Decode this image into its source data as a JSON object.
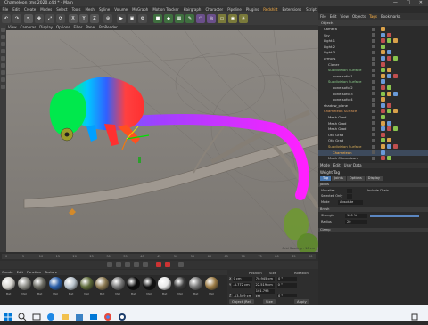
{
  "window": {
    "title": "Chameleon tms 2020.c4d * - Main",
    "controls": "— □ ✕"
  },
  "menubar": [
    "File",
    "Edit",
    "Create",
    "Modes",
    "Select",
    "Tools",
    "Mesh",
    "Spline",
    "Volume",
    "MoGraph",
    "Motion Tracker",
    "Hairgraph",
    "Character",
    "Pipeline",
    "Plugins",
    "Redshift",
    "Extensions",
    "Script",
    "Window",
    "Help"
  ],
  "menubar_highlight": "Redshift",
  "viewport": {
    "menu": [
      "View",
      "Cameras",
      "Display",
      "Options",
      "Filter",
      "Panel",
      "ProRender"
    ],
    "grid_spacing": "Grid Spacing : 10 cm"
  },
  "timeline": {
    "ticks": [
      "0",
      "5",
      "10",
      "15",
      "20",
      "25",
      "30",
      "35",
      "40",
      "45",
      "50",
      "55",
      "60",
      "65",
      "70",
      "75",
      "80",
      "85",
      "90"
    ]
  },
  "materials": {
    "menu": [
      "Create",
      "Edit",
      "Function",
      "Texture"
    ],
    "swatches": [
      {
        "label": "Mat",
        "color": "#d8d6d0"
      },
      {
        "label": "Mat",
        "color": "#8a8a84"
      },
      {
        "label": "Mat",
        "color": "#6a6a62"
      },
      {
        "label": "Mat",
        "color": "#2c5fa8"
      },
      {
        "label": "Mat",
        "color": "#b9c3cc"
      },
      {
        "label": "Mat",
        "color": "#5e6b3a"
      },
      {
        "label": "Mat",
        "color": "#8c7a52"
      },
      {
        "label": "Mat",
        "color": "#777"
      },
      {
        "label": "Mat",
        "color": "#0b0b0b"
      },
      {
        "label": "Mat",
        "color": "#111"
      },
      {
        "label": "Mat",
        "color": "#e8e8e8"
      },
      {
        "label": "Mat",
        "color": "#3c3c3c"
      },
      {
        "label": "Mat",
        "color": "#777"
      },
      {
        "label": "Mat",
        "color": "#9b7b45"
      }
    ]
  },
  "coordinates": {
    "headers": [
      "Position",
      "Size",
      "Rotation"
    ],
    "rows": [
      {
        "axis": "X",
        "pos": "0 cm",
        "size": "70.945 cm",
        "rot": "0 °"
      },
      {
        "axis": "Y",
        "pos": "-4.772 cm",
        "size": "22.519 cm",
        "rot": "0 °"
      },
      {
        "axis": "Z",
        "pos": "-13.549 cm",
        "size": "101.795 cm",
        "rot": "0 °"
      }
    ],
    "mode": "Object (Rel)",
    "size_mode": "Size",
    "apply": "Apply"
  },
  "objects_panel": {
    "menu": [
      "File",
      "Edit",
      "View",
      "Objects",
      "Tags",
      "Bookmarks"
    ],
    "menu_highlight": "Tags",
    "header": "Objects",
    "items": [
      {
        "name": "Camera",
        "indent": 0,
        "color": "#cfcfcf"
      },
      {
        "name": "Sky",
        "indent": 0,
        "color": "#cfcfcf"
      },
      {
        "name": "Light.1",
        "indent": 0,
        "color": "#cfcfcf"
      },
      {
        "name": "Light.2",
        "indent": 0,
        "color": "#cfcfcf"
      },
      {
        "name": "Light.3",
        "indent": 0,
        "color": "#cfcfcf"
      },
      {
        "name": "armors",
        "indent": 0,
        "color": "#cfcfcf"
      },
      {
        "name": "Cloner",
        "indent": 1,
        "color": "#cfcfcf"
      },
      {
        "name": "Subdivision Surface",
        "indent": 1,
        "color": "#8fd18f"
      },
      {
        "name": "bone.sofor1",
        "indent": 2,
        "color": "#cfcfcf"
      },
      {
        "name": "Subdivision Surface",
        "indent": 1,
        "color": "#8fd18f"
      },
      {
        "name": "bone.sofor2",
        "indent": 2,
        "color": "#cfcfcf"
      },
      {
        "name": "bone.sofor3",
        "indent": 2,
        "color": "#cfcfcf"
      },
      {
        "name": "bone.sofor4",
        "indent": 2,
        "color": "#cfcfcf"
      },
      {
        "name": "shadow_plane",
        "indent": 0,
        "color": "#cfcfcf"
      },
      {
        "name": "Chameleon Surface",
        "indent": 0,
        "color": "#e09a5a"
      },
      {
        "name": "Mesh Grad",
        "indent": 1,
        "color": "#cfcfcf"
      },
      {
        "name": "Mesh Grad",
        "indent": 1,
        "color": "#cfcfcf"
      },
      {
        "name": "Mesh Grad",
        "indent": 1,
        "color": "#cfcfcf"
      },
      {
        "name": "Oth Grad",
        "indent": 1,
        "color": "#cfcfcf"
      },
      {
        "name": "Oth Grad",
        "indent": 1,
        "color": "#cfcfcf"
      },
      {
        "name": "Subdivision Surface",
        "indent": 1,
        "color": "#e0b35a"
      },
      {
        "name": "Chameleon",
        "indent": 2,
        "color": "#ffb347"
      },
      {
        "name": "Mesh Chameleon",
        "indent": 1,
        "color": "#cfcfcf"
      }
    ]
  },
  "attributes_panel": {
    "menu": [
      "Mode",
      "Edit",
      "User Data"
    ],
    "title": "Weight Tag",
    "tabs": [
      "Tag",
      "Joints",
      "Options",
      "Display"
    ],
    "active_tab": "Tag",
    "sections": [
      "Joints",
      "Brush",
      "Clamp"
    ],
    "joint_props": [
      {
        "label": "Visualize",
        "value": ""
      },
      {
        "label": "Selected Only",
        "value": ""
      },
      {
        "label": "Include Chain",
        "value": ""
      },
      {
        "label": "Mode",
        "value": "Absolute"
      }
    ],
    "brush_props": [
      {
        "label": "Radius",
        "value": "20"
      },
      {
        "label": "Strength",
        "value": "100 %"
      }
    ]
  }
}
